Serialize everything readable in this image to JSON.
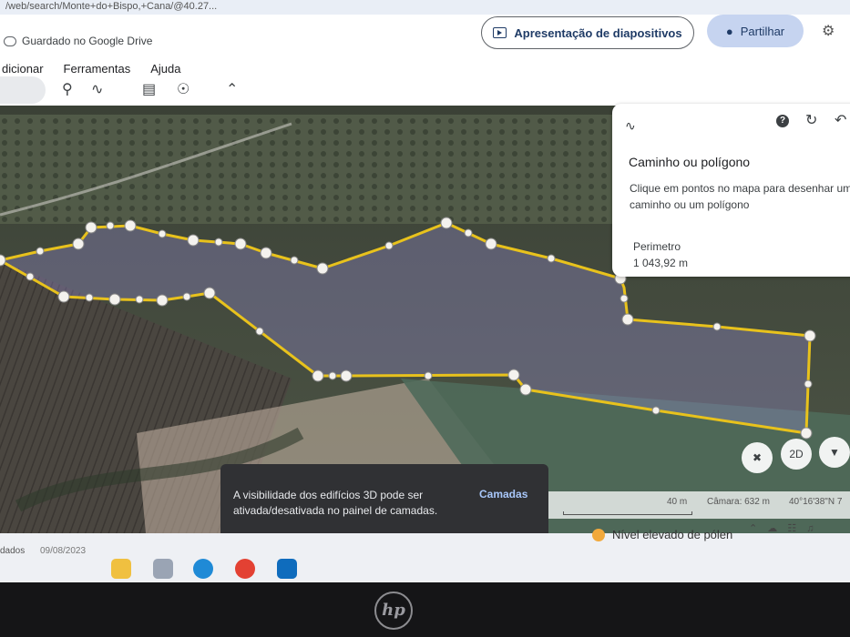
{
  "browser": {
    "url": "/web/search/Monte+do+Bispo,+Cana/@40.27..."
  },
  "header": {
    "saved_text": "Guardado no Google Drive",
    "present_label": "Apresentação de diapositivos",
    "share_label": "Partilhar"
  },
  "menu": {
    "items": [
      "dicionar",
      "Ferramentas",
      "Ajuda"
    ]
  },
  "panel": {
    "title": "Caminho ou polígono",
    "description": "Clique em pontos no mapa para desenhar um caminho ou um polígono",
    "measure_label": "Perimetro",
    "measure_value": "1 043,92 m",
    "help_glyph": "?"
  },
  "map_controls": {
    "view_2d_label": "2D"
  },
  "toast": {
    "message": "A visibilidade dos edifícios 3D pode ser ativada/desativada no painel de camadas.",
    "action": "Camadas"
  },
  "status": {
    "scale": "40 m",
    "camera": "Câmara: 632 m",
    "coords": "40°16'38\"N 7"
  },
  "taskbar": {
    "left_text": "dados",
    "date": "09/08/2023",
    "pollen": "Nível elevado de pólen"
  },
  "colors": {
    "polygon_stroke": "#e8c21c",
    "polygon_fill": "rgba(150,140,210,0.35)",
    "accent": "#1f3b66",
    "share_bg": "#c6d4f0",
    "toast_bg": "#303134",
    "toast_action": "#a8c7fa"
  },
  "brand": "hp"
}
